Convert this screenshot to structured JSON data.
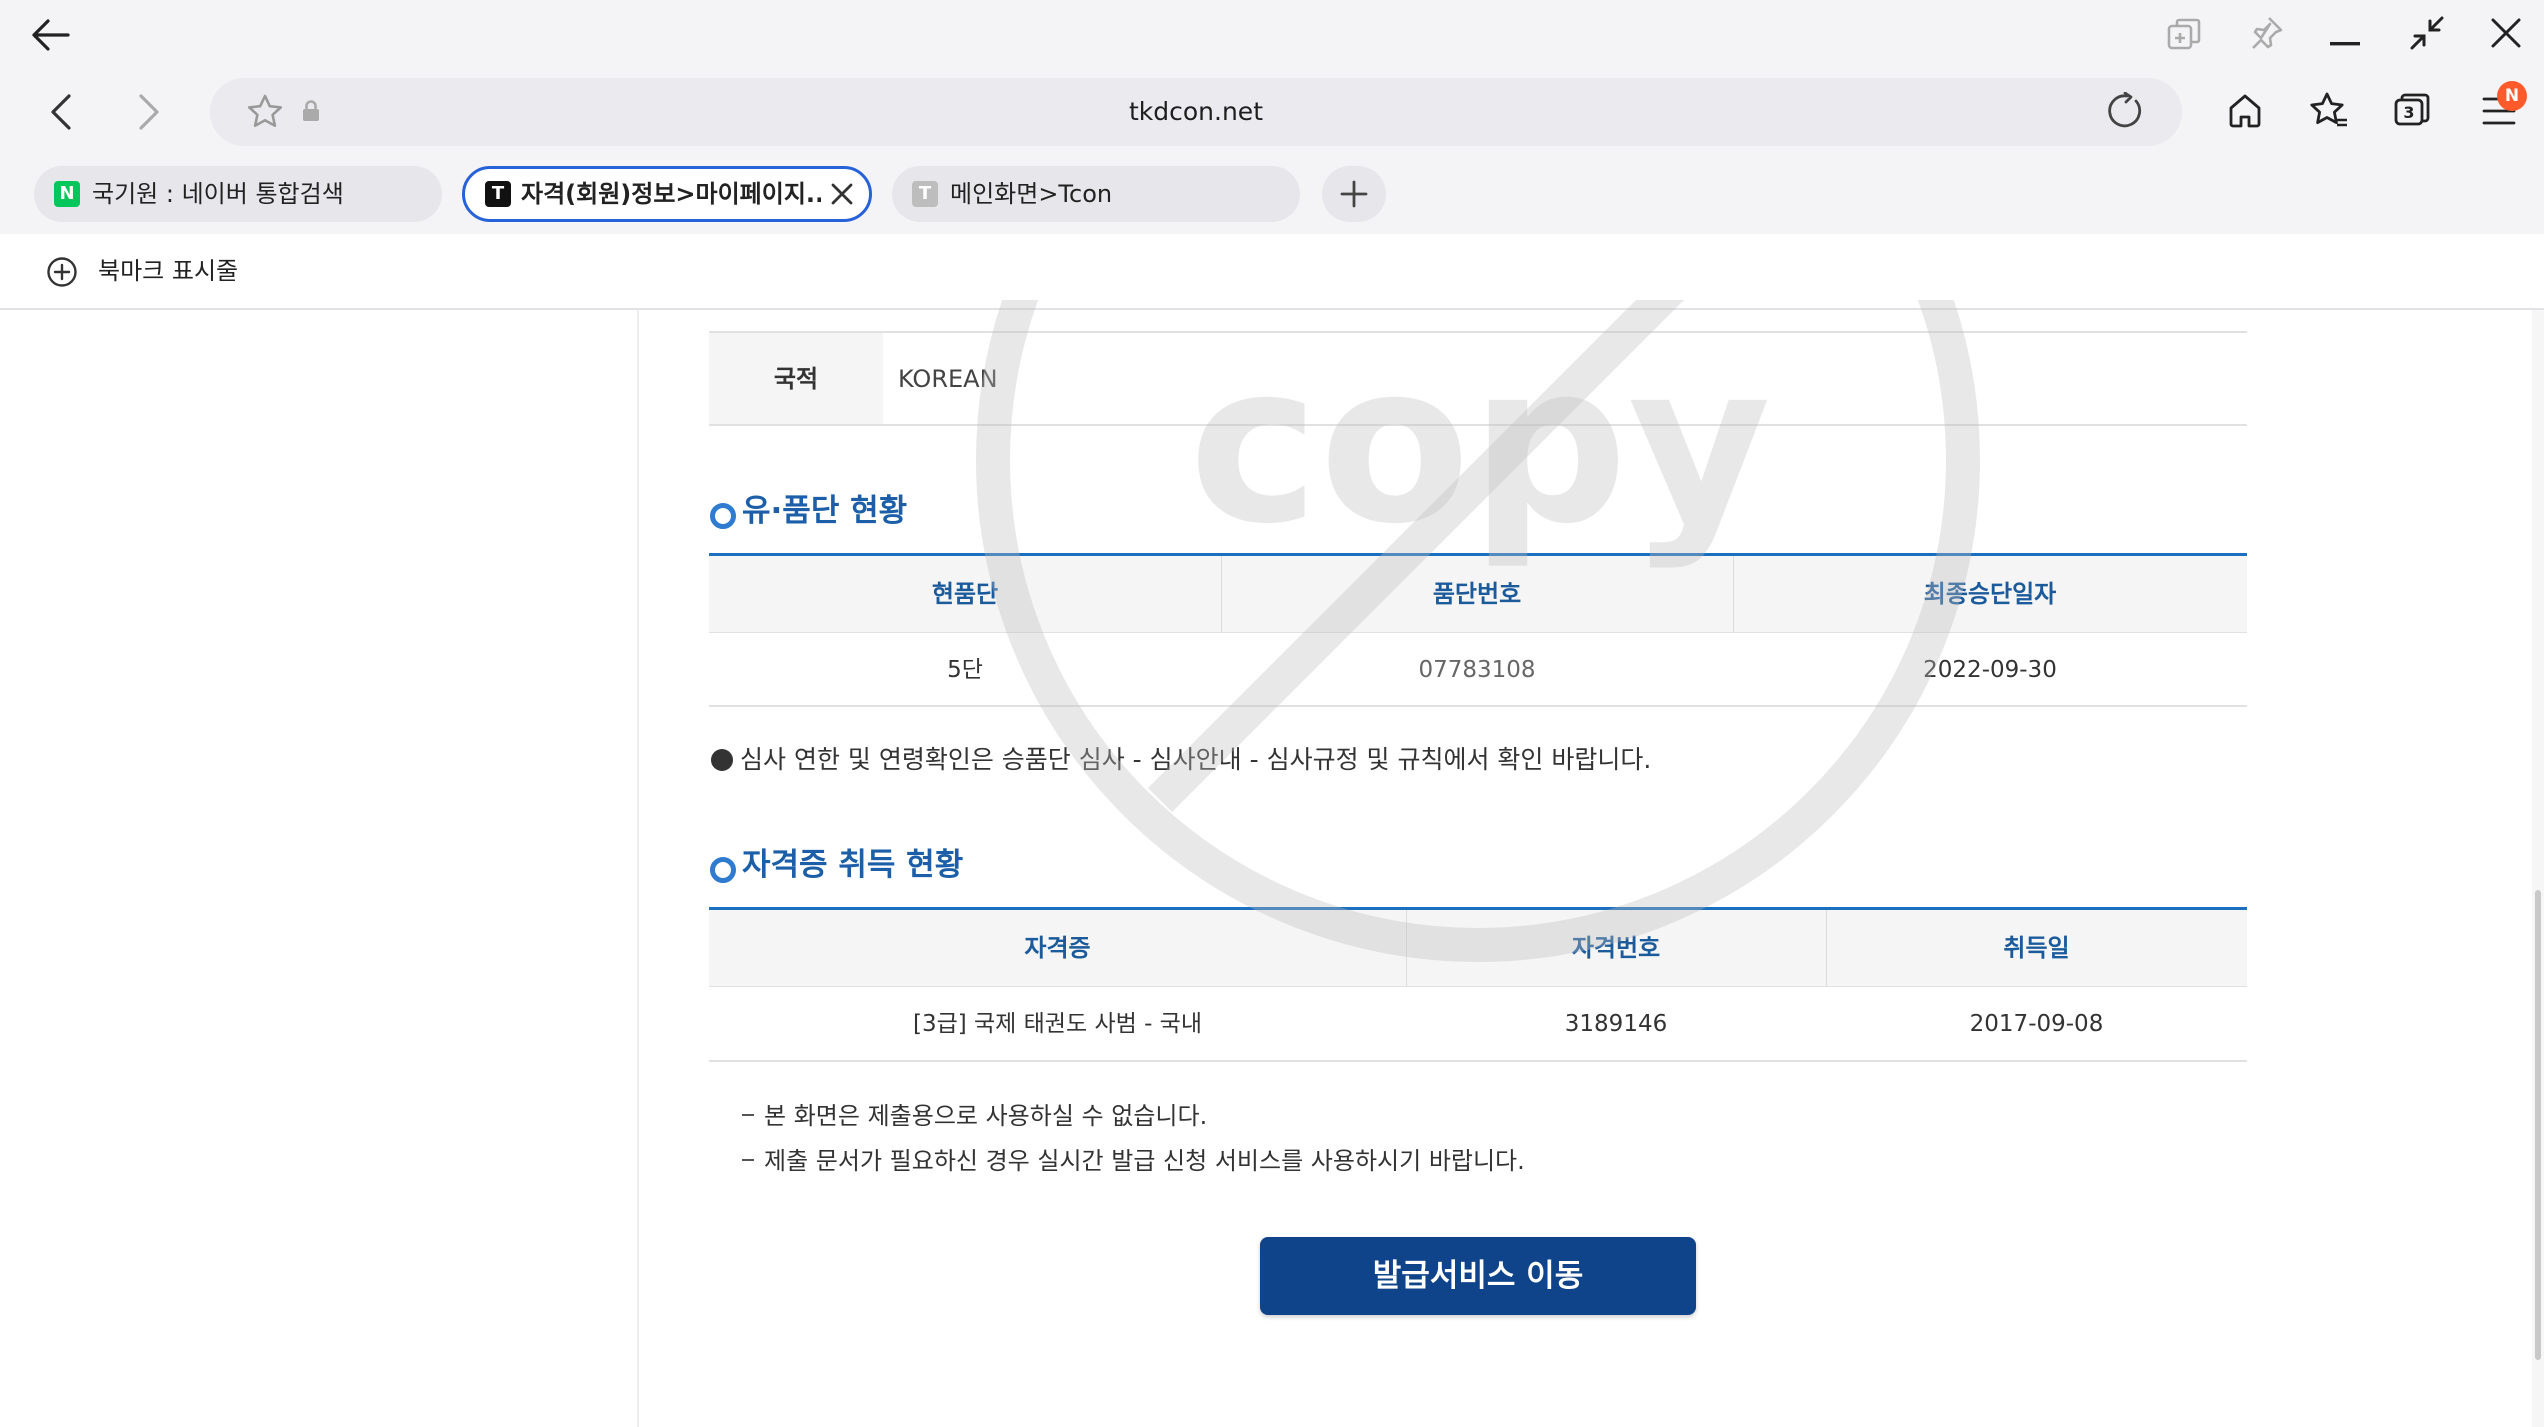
{
  "browser": {
    "url": "tkdcon.net",
    "notification_badge": "N",
    "tab_count_badge": "3",
    "accent_color": "#2862d8",
    "tabs": [
      {
        "label": "국기원 : 네이버 통합검색",
        "favicon": "N",
        "favicon_color": "#03c75a",
        "active": false
      },
      {
        "label": "자격(회원)정보>마이페이지...",
        "favicon": "T",
        "favicon_color": "#111111",
        "active": true
      },
      {
        "label": "메인화면>Tcon",
        "favicon": "T",
        "favicon_color": "#bdbdbd",
        "active": false
      }
    ],
    "bookmark_bar_label": "북마크 표시줄"
  },
  "page": {
    "nationality": {
      "label": "국적",
      "value": "KOREAN"
    },
    "watermark_text": "copy",
    "poom_section": {
      "title": "유·품단 현황",
      "headers": [
        "현품단",
        "품단번호",
        "최종승단일자"
      ],
      "rows": [
        [
          "5단",
          "07783108",
          "2022-09-30"
        ]
      ]
    },
    "notice": "심사 연한 및 연령확인은 승품단 심사 - 심사안내 - 심사규정 및 규칙에서 확인 바랍니다.",
    "cert_section": {
      "title": "자격증 취득 현황",
      "headers": [
        "자격증",
        "자격번호",
        "취득일"
      ],
      "rows": [
        [
          "[3급] 국제 태권도 사범 - 국내",
          "3189146",
          "2017-09-08"
        ]
      ]
    },
    "notes": [
      "본 화면은 제출용으로 사용하실 수 없습니다.",
      "제출 문서가 필요하신 경우 실시간 발급 신청 서비스를 사용하시기 바랍니다."
    ],
    "issue_button": "발급서비스 이동",
    "brand_color": "#10448a"
  }
}
